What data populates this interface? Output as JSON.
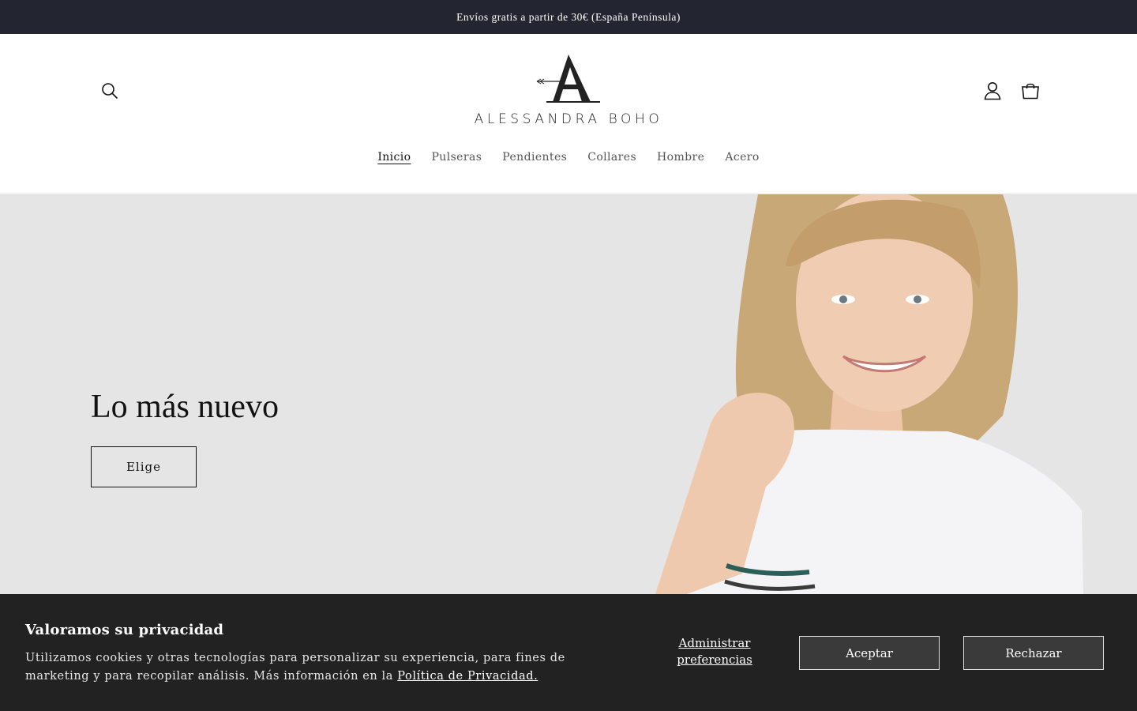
{
  "announcement": {
    "text": "Envíos gratis a partir de 30€ (España Península)"
  },
  "header": {
    "logo_text": "ALESSANDRA BOHO",
    "icons": {
      "search": "search-icon",
      "account": "user-icon",
      "cart": "cart-icon"
    }
  },
  "nav": {
    "items": [
      {
        "label": "Inicio",
        "active": true
      },
      {
        "label": "Pulseras"
      },
      {
        "label": "Pendientes"
      },
      {
        "label": "Collares"
      },
      {
        "label": "Hombre"
      },
      {
        "label": "Acero"
      }
    ]
  },
  "hero": {
    "title": "Lo más nuevo",
    "button_label": "Elige"
  },
  "cookie_banner": {
    "title": "Valoramos su privacidad",
    "text": "Utilizamos cookies y otras tecnologías para personalizar su experiencia, para fines de marketing y para recopilar análisis. Más información en la",
    "policy_link": "Política de Privacidad.",
    "preferences_label": "Administrar preferencias",
    "accept_label": "Aceptar",
    "reject_label": "Rechazar"
  },
  "colors": {
    "announcement_bg": "#232630",
    "hero_bg": "#e5e5e5",
    "cookie_bg": "#222222",
    "cookie_button_bg": "#3a3a3a"
  }
}
